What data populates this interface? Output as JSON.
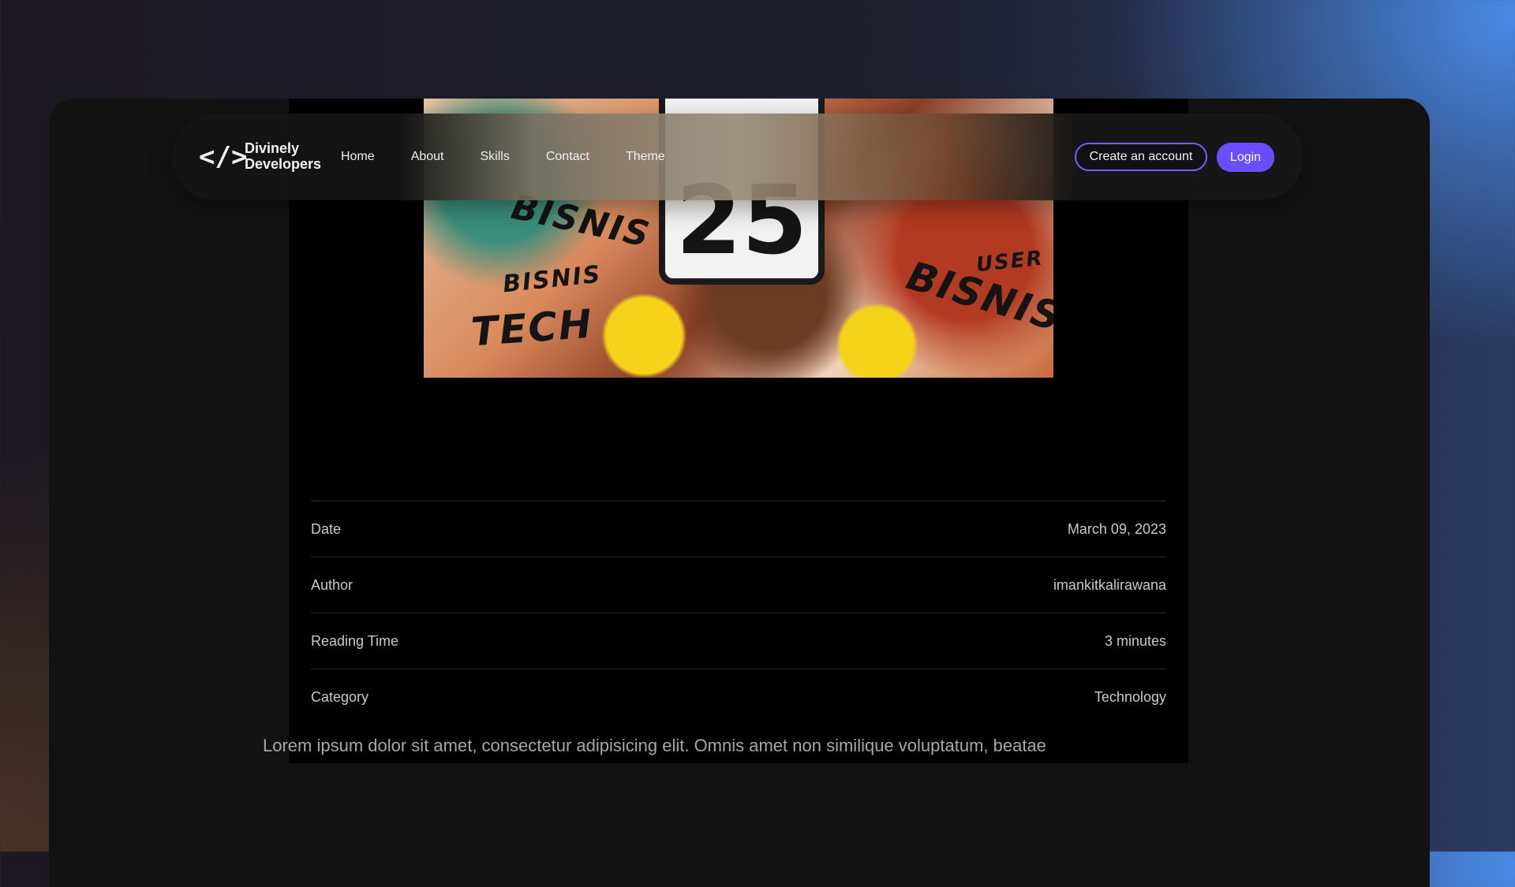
{
  "brand": {
    "line1": "Divinely",
    "line2": "Developers",
    "logo_glyph": "</>"
  },
  "nav": {
    "links": [
      "Home",
      "About",
      "Skills",
      "Contact",
      "Theme"
    ],
    "create_account": "Create an account",
    "login": "Login"
  },
  "hero": {
    "sign_number": "25",
    "graffiti": [
      "BISNIS",
      "BISNIS",
      "TECH",
      "USER",
      "BISNIS"
    ]
  },
  "meta": [
    {
      "label": "Date",
      "value": "March 09, 2023"
    },
    {
      "label": "Author",
      "value": "imankitkalirawana"
    },
    {
      "label": "Reading Time",
      "value": "3 minutes"
    },
    {
      "label": "Category",
      "value": "Technology"
    }
  ],
  "body": {
    "paragraph": "Lorem ipsum dolor sit amet, consectetur adipisicing elit. Omnis amet non similique voluptatum, beatae"
  },
  "colors": {
    "accent": "#6b4dff",
    "accent_border": "#7b5cff",
    "article_bg": "#000000",
    "frame_bg": "#121212"
  }
}
